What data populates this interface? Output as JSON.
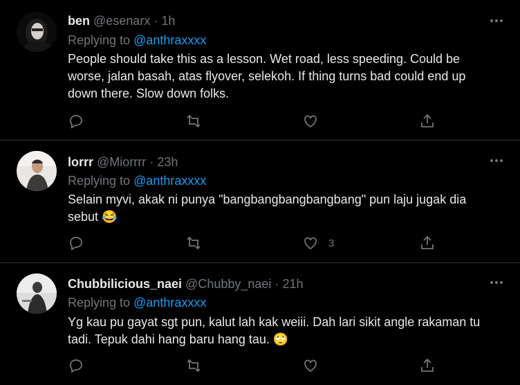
{
  "tweets": [
    {
      "name": "ben",
      "handle": "@esenarx",
      "sep": "·",
      "time": "1h",
      "replying_prefix": "Replying to",
      "replying_to": "@anthraxxxx",
      "lines": [
        "People should take this as a lesson. Wet road, less speeding. Could be",
        "worse, jalan basah, atas flyover, selekoh. If thing turns bad could end up",
        "down there. Slow down folks."
      ],
      "like_count": ""
    },
    {
      "name": "lorrr",
      "handle": "@Miorrrr",
      "sep": "·",
      "time": "23h",
      "replying_prefix": "Replying to",
      "replying_to": "@anthraxxxx",
      "lines": [
        "Selain myvi, akak ni punya \"bangbangbangbangbang\" pun laju jugak dia",
        "sebut 😂"
      ],
      "like_count": "3"
    },
    {
      "name": "Chubbilicious_naei",
      "handle": "@Chubby_naei",
      "sep": "·",
      "time": "21h",
      "replying_prefix": "Replying to",
      "replying_to": "@anthraxxxx",
      "lines": [
        "Yg kau pu gayat sgt pun, kalut lah kak weiii. Dah lari sikit angle rakaman tu",
        "tadi. Tepuk dahi hang baru hang tau. 🙄"
      ],
      "like_count": ""
    }
  ],
  "icons": {
    "more": "more-horizontal-icon",
    "reply": "reply-icon",
    "retweet": "retweet-icon",
    "like": "heart-icon",
    "share": "share-icon"
  },
  "colors": {
    "background": "#000000",
    "text": "#e7e9ea",
    "muted": "#71767b",
    "link": "#1d9bf0",
    "divider": "#2f3336"
  }
}
